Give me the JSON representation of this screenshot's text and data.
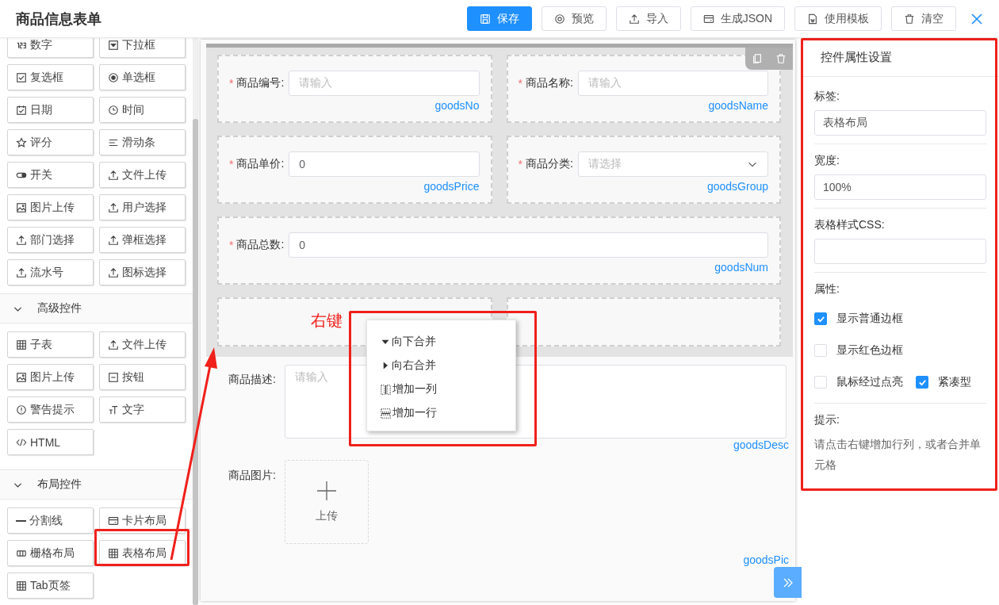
{
  "header": {
    "title": "商品信息表单",
    "buttons": [
      {
        "label": "保存",
        "kind": "primary"
      },
      {
        "label": "预览",
        "kind": "default"
      },
      {
        "label": "导入",
        "kind": "default"
      },
      {
        "label": "生成JSON",
        "kind": "default"
      },
      {
        "label": "使用模板",
        "kind": "default"
      },
      {
        "label": "清空",
        "kind": "default"
      }
    ]
  },
  "sidebar": {
    "basic_items": [
      {
        "label": "数字"
      },
      {
        "label": "下拉框"
      },
      {
        "label": "复选框"
      },
      {
        "label": "单选框"
      },
      {
        "label": "日期"
      },
      {
        "label": "时间"
      },
      {
        "label": "评分"
      },
      {
        "label": "滑动条"
      },
      {
        "label": "开关"
      },
      {
        "label": "文件上传"
      },
      {
        "label": "图片上传"
      },
      {
        "label": "用户选择"
      },
      {
        "label": "部门选择"
      },
      {
        "label": "弹框选择"
      },
      {
        "label": "流水号"
      },
      {
        "label": "图标选择"
      }
    ],
    "sections": [
      {
        "title": "高级控件",
        "expanded": true,
        "items": [
          {
            "label": "子表"
          },
          {
            "label": "文件上传"
          },
          {
            "label": "图片上传"
          },
          {
            "label": "按钮"
          },
          {
            "label": "警告提示"
          },
          {
            "label": "文字"
          },
          {
            "label": "HTML"
          }
        ]
      },
      {
        "title": "布局控件",
        "expanded": true,
        "items": [
          {
            "label": "分割线"
          },
          {
            "label": "卡片布局"
          },
          {
            "label": "栅格布局"
          },
          {
            "label": "表格布局"
          },
          {
            "label": "Tab页签"
          }
        ]
      }
    ]
  },
  "form": {
    "table": {
      "rows": [
        {
          "cells": [
            {
              "kind": "input",
              "mark": "*",
              "label": "商品编号:",
              "placeholder": "请输入",
              "field": "goodsNo"
            },
            {
              "kind": "input",
              "mark": "*",
              "label": "商品名称:",
              "placeholder": "请输入",
              "field": "goodsName"
            }
          ]
        },
        {
          "cells": [
            {
              "kind": "input",
              "mark": "*",
              "label": "商品单价:",
              "value": "0",
              "field": "goodsPrice"
            },
            {
              "kind": "select",
              "mark": "*",
              "label": "商品分类:",
              "placeholder": "请选择",
              "field": "goodsGroup"
            }
          ]
        },
        {
          "cells": [
            {
              "kind": "input",
              "mark": "*",
              "label": "商品总数:",
              "value": "0",
              "field": "goodsNum"
            }
          ]
        },
        {
          "cells": [
            {
              "kind": "empty"
            },
            {
              "kind": "empty"
            }
          ]
        }
      ]
    },
    "fields": [
      {
        "kind": "textarea",
        "label": "商品描述:",
        "placeholder": "请输入",
        "field": "goodsDesc"
      },
      {
        "kind": "upload",
        "label": "商品图片:",
        "upload_label": "上传",
        "field": "goodsPic"
      }
    ]
  },
  "annotation": {
    "label": "右键",
    "menu": [
      {
        "kind": "merge-down",
        "label": "向下合并"
      },
      {
        "kind": "merge-right",
        "label": "向右合并"
      },
      {
        "kind": "add-column",
        "label": "增加一列"
      },
      {
        "kind": "add-row",
        "label": "增加一行"
      }
    ]
  },
  "properties": {
    "title": "控件属性设置",
    "fields": [
      {
        "label": "标签:",
        "value": "表格布局"
      },
      {
        "label": "宽度:",
        "value": "100%"
      },
      {
        "label": "表格样式CSS:"
      }
    ],
    "options_label": "属性:",
    "option_rows": [
      {
        "items": [
          {
            "label": "显示普通边框",
            "checked": true
          }
        ]
      },
      {
        "items": [
          {
            "label": "显示红色边框",
            "checked": false
          }
        ]
      },
      {
        "items": [
          {
            "label": "鼠标经过点亮",
            "checked": false
          },
          {
            "label": "紧凑型",
            "checked": true
          }
        ]
      }
    ],
    "hint_label": "提示:",
    "hint": "请点击右键增加行列，或者合并单元格"
  }
}
